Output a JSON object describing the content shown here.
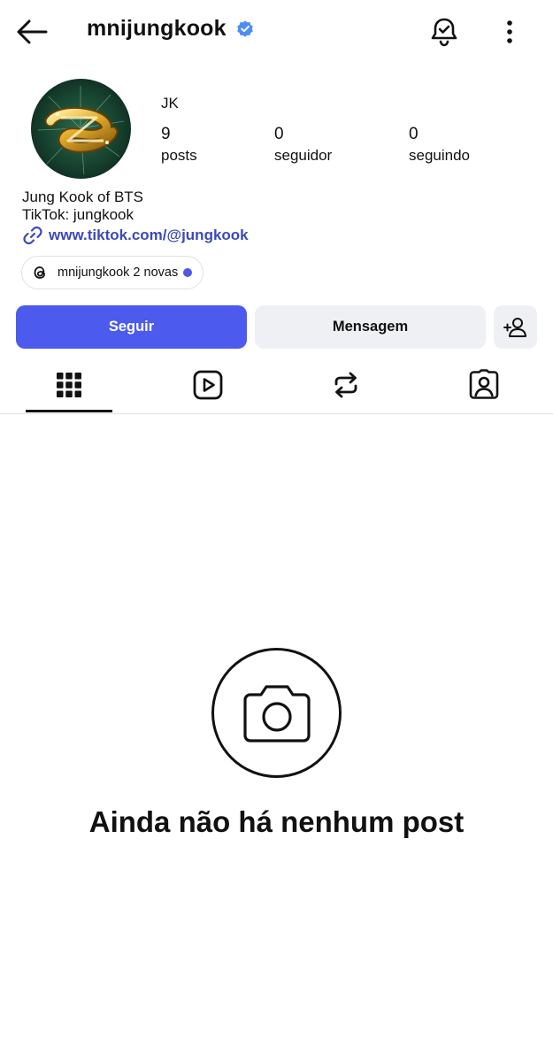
{
  "header": {
    "username": "mnijungkook",
    "verified": true
  },
  "profile": {
    "display_name": "JK",
    "avatar_icon": "gold-logo-avatar",
    "stats": [
      {
        "value": "9",
        "label": "posts"
      },
      {
        "value": "0",
        "label": "seguidor"
      },
      {
        "value": "0",
        "label": "seguindo"
      }
    ],
    "bio_lines": [
      "Jung Kook of BTS",
      "TikTok: jungkook"
    ],
    "link": "www.tiktok.com/@jungkook",
    "threads_chip": "mnijungkook 2 novas"
  },
  "actions": {
    "follow": "Seguir",
    "message": "Mensagem"
  },
  "tabs": [
    {
      "icon": "grid-icon",
      "active": true
    },
    {
      "icon": "reels-icon",
      "active": false
    },
    {
      "icon": "repost-icon",
      "active": false
    },
    {
      "icon": "tagged-icon",
      "active": false
    }
  ],
  "empty_state": {
    "icon": "camera-icon",
    "title": "Ainda não há nenhum post"
  },
  "colors": {
    "accent": "#4d5aee",
    "link": "#3b4ab8",
    "verified": "#4c8df6",
    "secondary_button": "#eff0f4"
  }
}
